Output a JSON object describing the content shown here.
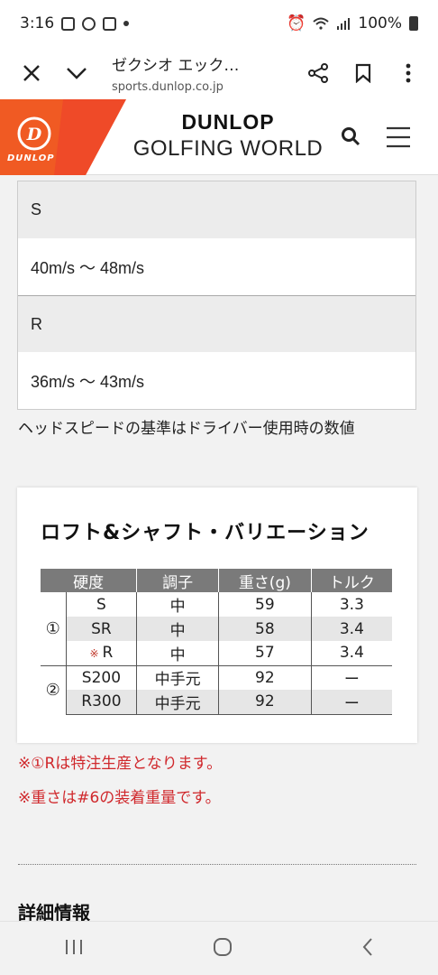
{
  "status_bar": {
    "time": "3:16",
    "battery": "100%"
  },
  "browser": {
    "page_title": "ゼクシオ エック…",
    "url": "sports.dunlop.co.jp"
  },
  "header": {
    "brand_line1": "DUNLOP",
    "brand_line2": "GOLFING WORLD",
    "logo_text": "DUNLOP"
  },
  "headspeed_table": [
    {
      "flex": "S",
      "range": "40m/s 〜 48m/s"
    },
    {
      "flex": "R",
      "range": "36m/s 〜 43m/s"
    }
  ],
  "headspeed_note": "ヘッドスピードの基準はドライバー使用時の数値",
  "variation": {
    "title": "ロフト&シャフト・バリエーション",
    "columns": [
      "硬度",
      "調子",
      "重さ(g)",
      "トルク"
    ],
    "groups": [
      {
        "mark": "①",
        "rows": [
          {
            "flex": "S",
            "kick": "中",
            "weight": "59",
            "torque": "3.3",
            "note_mark": ""
          },
          {
            "flex": "SR",
            "kick": "中",
            "weight": "58",
            "torque": "3.4",
            "note_mark": ""
          },
          {
            "flex": "R",
            "kick": "中",
            "weight": "57",
            "torque": "3.4",
            "note_mark": "※"
          }
        ]
      },
      {
        "mark": "②",
        "rows": [
          {
            "flex": "S200",
            "kick": "中手元",
            "weight": "92",
            "torque": "ー",
            "note_mark": ""
          },
          {
            "flex": "R300",
            "kick": "中手元",
            "weight": "92",
            "torque": "ー",
            "note_mark": ""
          }
        ]
      }
    ]
  },
  "red_notes": [
    "※①Rは特注生産となります。",
    "※重さは#6の装着重量です。"
  ],
  "section_heading": "詳細情報",
  "colors": {
    "accent_orange": "#f05a23",
    "note_red": "#d0282c"
  }
}
